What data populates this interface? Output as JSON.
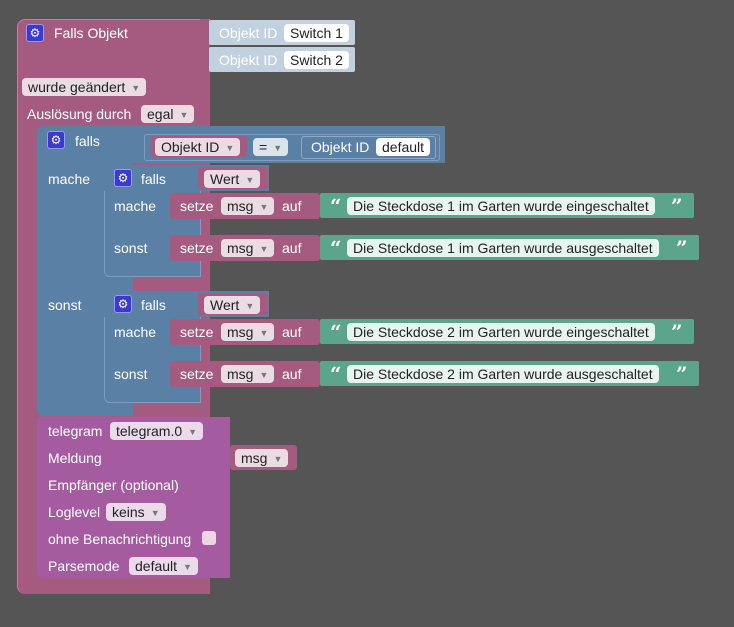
{
  "trigger": {
    "title": "Falls Objekt",
    "object_label": "Objekt ID",
    "objects": [
      "Switch 1",
      "Switch 2"
    ],
    "condition": "wurde geändert",
    "trigger_by_label": "Auslösung durch",
    "trigger_by_value": "egal"
  },
  "if_outer": {
    "falls_label": "falls",
    "mache_label": "mache",
    "sonst_label": "sonst",
    "cond_left_label": "Objekt ID",
    "operator": "=",
    "cond_right_label": "Objekt ID",
    "cond_right_value": "default"
  },
  "if_inner_1": {
    "falls_label": "falls",
    "value_label": "Wert",
    "mache_label": "mache",
    "sonst_label": "sonst",
    "set_label": "setze",
    "var_name": "msg",
    "auf_label": "auf",
    "text_on": "Die Steckdose 1 im Garten wurde eingeschaltet",
    "text_off": "Die Steckdose 1 im Garten wurde ausgeschaltet"
  },
  "if_inner_2": {
    "falls_label": "falls",
    "value_label": "Wert",
    "mache_label": "mache",
    "sonst_label": "sonst",
    "set_label": "setze",
    "var_name": "msg",
    "auf_label": "auf",
    "text_on": "Die Steckdose 2 im Garten wurde eingeschaltet",
    "text_off": "Die Steckdose 2 im Garten wurde ausgeschaltet"
  },
  "telegram": {
    "telegram_label": "telegram",
    "telegram_instance": "telegram.0",
    "message_label": "Meldung",
    "message_var": "msg",
    "recipient_label": "Empfänger (optional)",
    "loglevel_label": "Loglevel",
    "loglevel_value": "keins",
    "silent_label": "ohne Benachrichtigung",
    "parsemode_label": "Parsemode",
    "parsemode_value": "default"
  },
  "symbols": {
    "gear": "⚙",
    "dropdown_arrow": "▼",
    "quote_open": "“",
    "quote_close": "”"
  },
  "colors": {
    "background": "#555555",
    "trigger_block": "#a55b80",
    "logic_block": "#5b80a5",
    "variable_block": "#a55b80",
    "text_block": "#5ba58c",
    "telegram_block": "#a55ba0",
    "object_id_block": "#c2d1e0",
    "gear_icon": "#3a39d0"
  }
}
